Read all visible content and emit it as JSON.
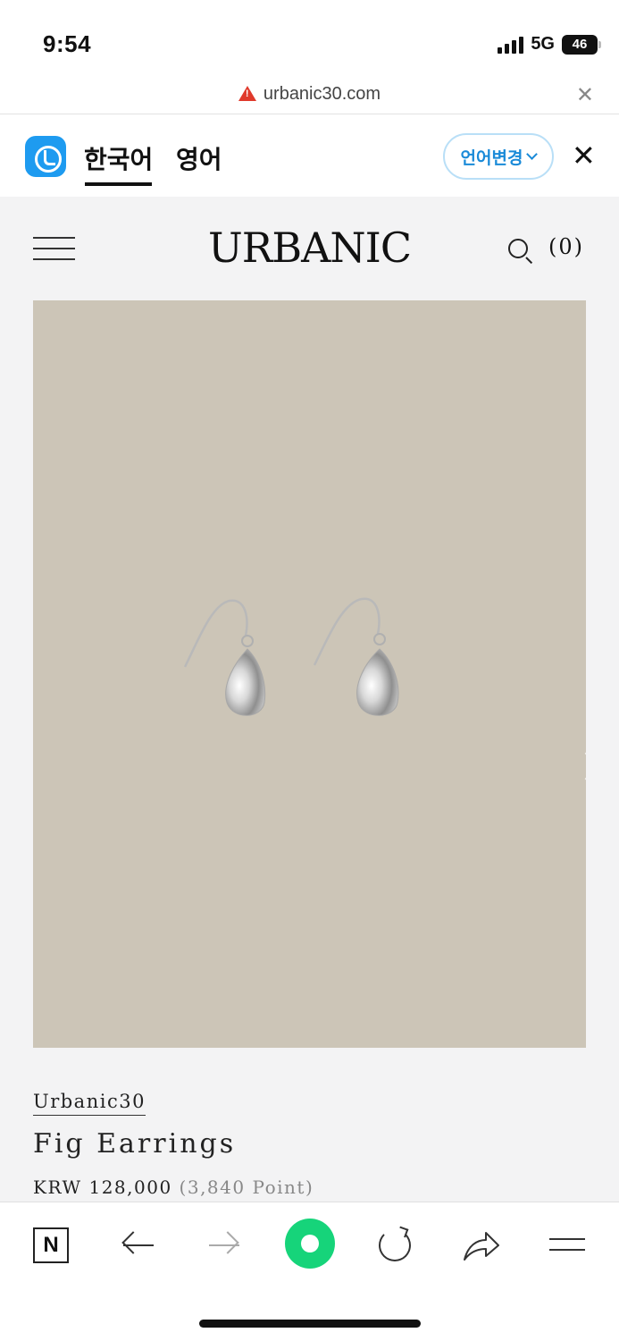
{
  "status": {
    "time": "9:54",
    "network": "5G",
    "battery": "46"
  },
  "browser": {
    "url": "urbanic30.com"
  },
  "translate": {
    "lang_korean": "한국어",
    "lang_english": "영어",
    "change_button": "언어변경"
  },
  "site": {
    "logo": "URBANIC",
    "cart": "(0)"
  },
  "product": {
    "brand": "Urbanic30",
    "name": "Fig Earrings",
    "price": "KRW 128,000",
    "points": "(3,840 Point)"
  },
  "icons": [
    "warning-icon",
    "close-icon",
    "papago-icon",
    "chevron-down-icon",
    "menu-icon",
    "search-icon",
    "chevron-right-icon",
    "naver-icon",
    "back-arrow-icon",
    "forward-arrow-icon",
    "green-dot-icon",
    "refresh-icon",
    "share-icon"
  ],
  "colors": {
    "accent_blue": "#1a8ad8",
    "green": "#16d47a",
    "warning_red": "#e0392b",
    "image_bg": "#ccc5b7",
    "page_bg": "#f3f3f4"
  }
}
